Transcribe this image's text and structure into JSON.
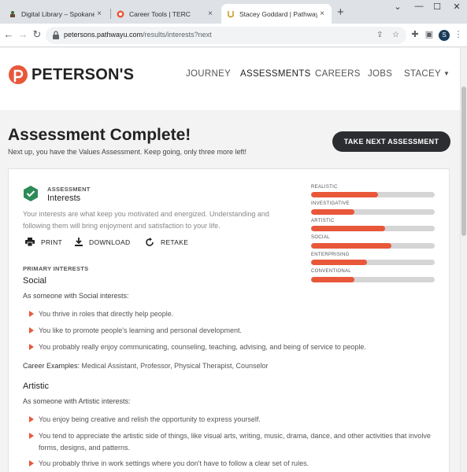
{
  "browser": {
    "tabs": [
      {
        "title": "Digital Library – Spokane County",
        "close": "×"
      },
      {
        "title": "Career Tools | TERC",
        "close": "×"
      },
      {
        "title": "Stacey Goddard | PathwayU",
        "close": "×"
      }
    ],
    "new_tab": "+",
    "url_host": "petersons.pathwayu.com",
    "url_path": "/results/interests?next",
    "profile_initial": "S"
  },
  "header": {
    "logo_text": "PETERSON'S",
    "nav": [
      "JOURNEY",
      "ASSESSMENTS",
      "CAREERS",
      "JOBS",
      "STACEY"
    ],
    "active_nav": "ASSESSMENTS"
  },
  "hero": {
    "title": "Assessment Complete!",
    "subtitle": "Next up, you have the Values Assessment. Keep going, only three more left!",
    "next_button": "TAKE NEXT ASSESSMENT"
  },
  "card": {
    "eyebrow": "ASSESSMENT",
    "title": "Interests",
    "description": "Your interests are what keep you motivated and energized. Understanding and following them will bring enjoyment and satisfaction to your life.",
    "actions": {
      "print": "PRINT",
      "download": "DOWNLOAD",
      "retake": "RETAKE"
    },
    "section_label": "PRIMARY INTERESTS",
    "interests": [
      {
        "name": "Social",
        "intro": "As someone with Social interests:",
        "bullets": [
          "You thrive in roles that directly help people.",
          "You like to promote people's learning and personal development.",
          "You probably really enjoy communicating, counseling, teaching, advising, and being of service to people."
        ],
        "examples_label": "Career Examples:",
        "examples": "Medical Assistant, Professor, Physical Therapist, Counselor"
      },
      {
        "name": "Artistic",
        "intro": "As someone with Artistic interests:",
        "bullets": [
          "You enjoy being creative and relish the opportunity to express yourself.",
          "You tend to appreciate the artistic side of things, like visual arts, writing, music, drama, dance, and other activities that involve forms, designs, and patterns.",
          "You probably thrive in work settings where you don't have to follow a clear set of rules."
        ]
      }
    ],
    "scores": [
      {
        "label": "REALISTIC",
        "value": 0.54
      },
      {
        "label": "INVESTIGATIVE",
        "value": 0.35
      },
      {
        "label": "ARTISTIC",
        "value": 0.6
      },
      {
        "label": "SOCIAL",
        "value": 0.65
      },
      {
        "label": "ENTERPRISING",
        "value": 0.45
      },
      {
        "label": "CONVENTIONAL",
        "value": 0.35
      }
    ]
  },
  "colors": {
    "accent": "#e8573a",
    "button_dark": "#2b2d30",
    "shield_green": "#2e8b57",
    "bar_track": "#d5d5d5"
  }
}
